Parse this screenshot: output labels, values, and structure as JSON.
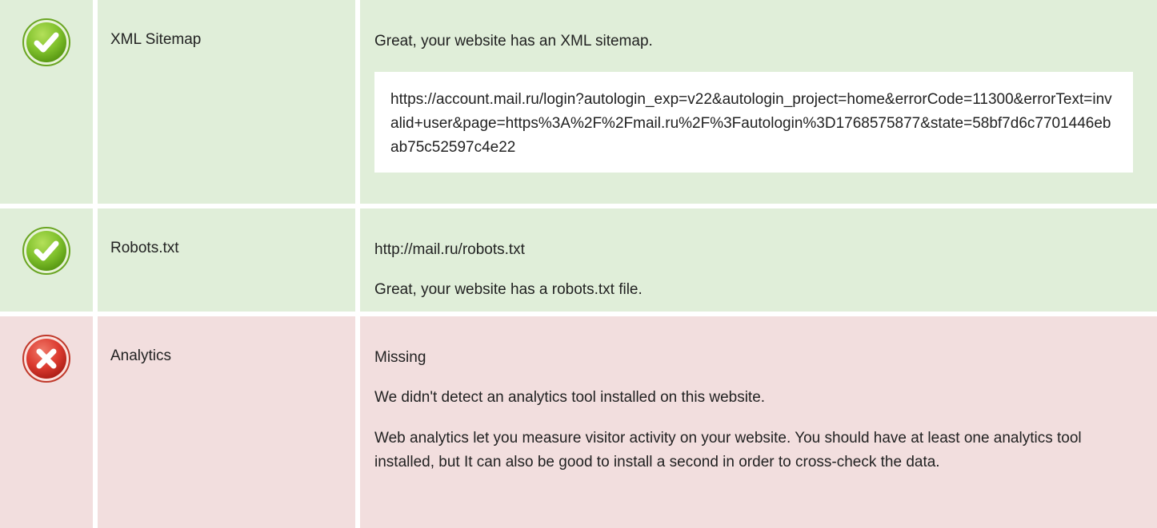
{
  "rows": [
    {
      "status": "pass",
      "status_icon": "check-circle-icon",
      "label": "XML Sitemap",
      "message": "Great, your website has an XML sitemap.",
      "url": "https://account.mail.ru/login?autologin_exp=v22&autologin_project=home&errorCode=11300&errorText=invalid+user&page=https%3A%2F%2Fmail.ru%2F%3Fautologin%3D1768575877&state=58bf7d6c7701446ebab75c52597c4e22"
    },
    {
      "status": "pass",
      "status_icon": "check-circle-icon",
      "label": "Robots.txt",
      "url": "http://mail.ru/robots.txt",
      "message": "Great, your website has a robots.txt file."
    },
    {
      "status": "fail",
      "status_icon": "cross-circle-icon",
      "label": "Analytics",
      "state": "Missing",
      "message": "We didn't detect an analytics tool installed on this website.",
      "advice": "Web analytics let you measure visitor activity on your website. You should have at least one analytics tool installed, but It can also be good to install a second in order to cross-check the data."
    }
  ],
  "colors": {
    "pass_bg": "#e0eed9",
    "fail_bg": "#f2dede",
    "pass_icon": "#7cbf2a",
    "fail_icon": "#d63a3a"
  }
}
